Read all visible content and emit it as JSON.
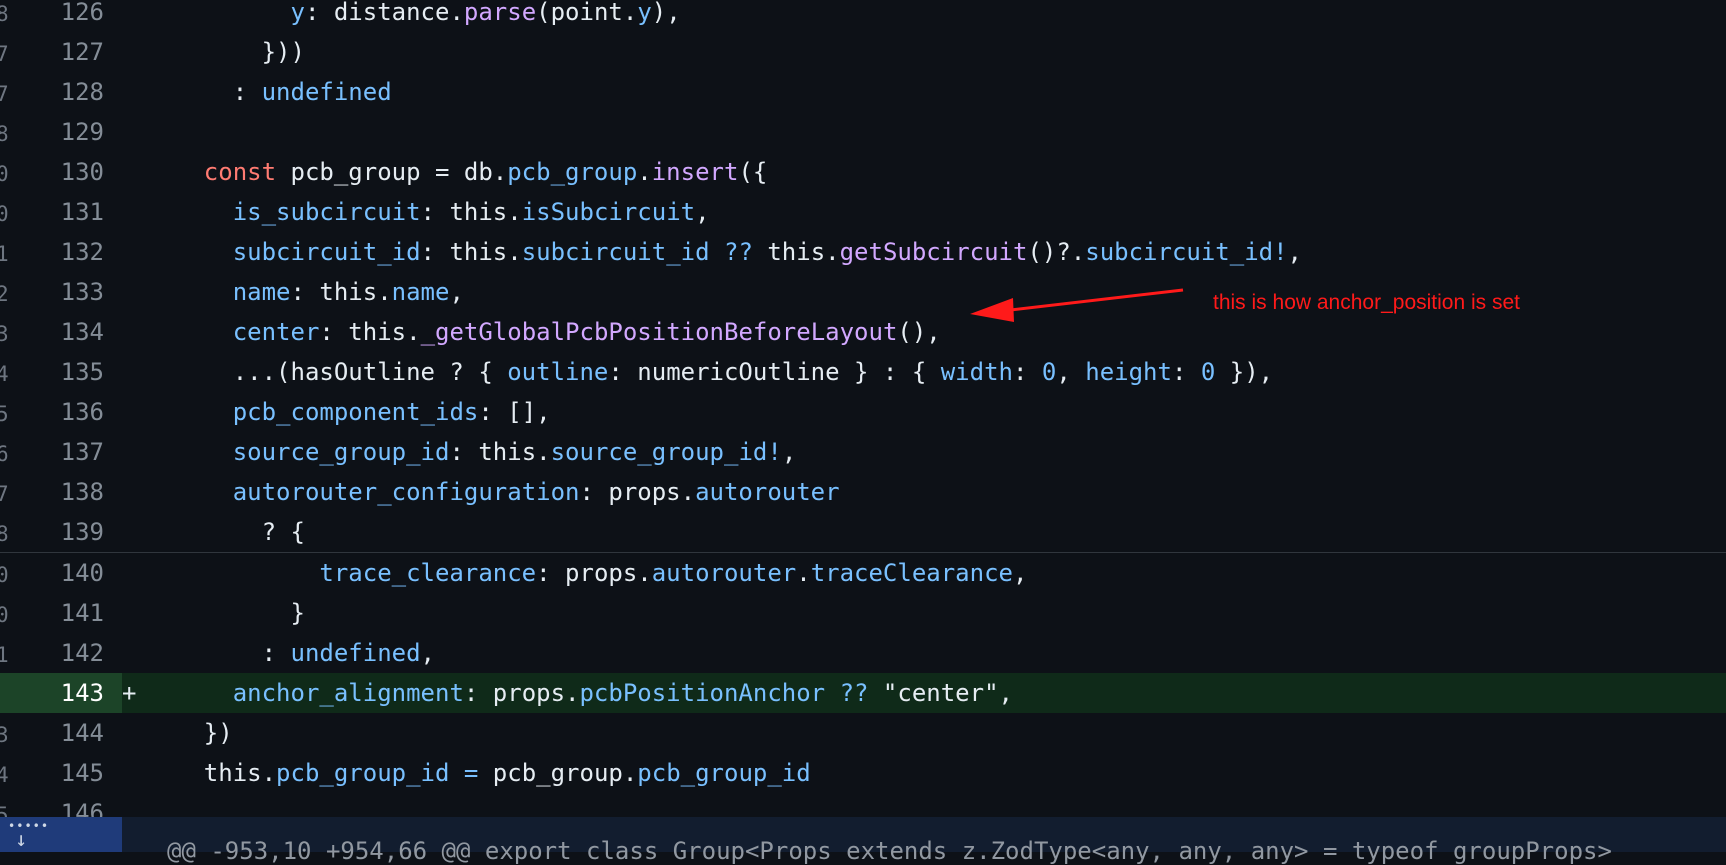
{
  "diff": {
    "lines": [
      {
        "num": "126",
        "g": "8",
        "type": "context",
        "tokens": [
          {
            "t": "          "
          },
          {
            "t": "y",
            "c": "pr"
          },
          {
            "t": ": distance."
          },
          {
            "t": "parse",
            "c": "fn"
          },
          {
            "t": "(point."
          },
          {
            "t": "y",
            "c": "pr"
          },
          {
            "t": "),"
          }
        ]
      },
      {
        "num": "127",
        "g": "7",
        "type": "context",
        "tokens": [
          {
            "t": "        }))"
          }
        ]
      },
      {
        "num": "128",
        "g": "7",
        "type": "context",
        "tokens": [
          {
            "t": "      : "
          },
          {
            "t": "undefined",
            "c": "pr"
          }
        ]
      },
      {
        "num": "129",
        "g": "8",
        "type": "context",
        "tokens": []
      },
      {
        "num": "130",
        "g": "0",
        "type": "context",
        "tokens": [
          {
            "t": "    "
          },
          {
            "t": "const",
            "c": "kw"
          },
          {
            "t": " pcb_group = db."
          },
          {
            "t": "pcb_group",
            "c": "pr"
          },
          {
            "t": "."
          },
          {
            "t": "insert",
            "c": "fn"
          },
          {
            "t": "({"
          }
        ]
      },
      {
        "num": "131",
        "g": "0",
        "type": "context",
        "tokens": [
          {
            "t": "      "
          },
          {
            "t": "is_subcircuit",
            "c": "pr"
          },
          {
            "t": ": this."
          },
          {
            "t": "isSubcircuit",
            "c": "pr"
          },
          {
            "t": ","
          }
        ]
      },
      {
        "num": "132",
        "g": "1",
        "type": "context",
        "tokens": [
          {
            "t": "      "
          },
          {
            "t": "subcircuit_id",
            "c": "pr"
          },
          {
            "t": ": this."
          },
          {
            "t": "subcircuit_id",
            "c": "pr"
          },
          {
            "t": " "
          },
          {
            "t": "??",
            "c": "pr"
          },
          {
            "t": " this."
          },
          {
            "t": "getSubcircuit",
            "c": "fn"
          },
          {
            "t": "()?."
          },
          {
            "t": "subcircuit_id",
            "c": "pr"
          },
          {
            "t": "!",
            "c": "pr"
          },
          {
            "t": ","
          }
        ]
      },
      {
        "num": "133",
        "g": "2",
        "type": "context",
        "tokens": [
          {
            "t": "      "
          },
          {
            "t": "name",
            "c": "pr"
          },
          {
            "t": ": this."
          },
          {
            "t": "name",
            "c": "pr"
          },
          {
            "t": ","
          }
        ]
      },
      {
        "num": "134",
        "g": "3",
        "type": "context",
        "tokens": [
          {
            "t": "      "
          },
          {
            "t": "center",
            "c": "pr"
          },
          {
            "t": ": this."
          },
          {
            "t": "_getGlobalPcbPositionBeforeLayout",
            "c": "fn"
          },
          {
            "t": "(),"
          }
        ]
      },
      {
        "num": "135",
        "g": "4",
        "type": "context",
        "tokens": [
          {
            "t": "      ...(hasOutline ? { "
          },
          {
            "t": "outline",
            "c": "pr"
          },
          {
            "t": ": numericOutline } : { "
          },
          {
            "t": "width",
            "c": "pr"
          },
          {
            "t": ": "
          },
          {
            "t": "0",
            "c": "pr"
          },
          {
            "t": ", "
          },
          {
            "t": "height",
            "c": "pr"
          },
          {
            "t": ": "
          },
          {
            "t": "0",
            "c": "pr"
          },
          {
            "t": " }),"
          }
        ]
      },
      {
        "num": "136",
        "g": "5",
        "type": "context",
        "tokens": [
          {
            "t": "      "
          },
          {
            "t": "pcb_component_ids",
            "c": "pr"
          },
          {
            "t": ": [],"
          }
        ]
      },
      {
        "num": "137",
        "g": "6",
        "type": "context",
        "tokens": [
          {
            "t": "      "
          },
          {
            "t": "source_group_id",
            "c": "pr"
          },
          {
            "t": ": this."
          },
          {
            "t": "source_group_id",
            "c": "pr"
          },
          {
            "t": "!",
            "c": "pr"
          },
          {
            "t": ","
          }
        ]
      },
      {
        "num": "138",
        "g": "7",
        "type": "context",
        "tokens": [
          {
            "t": "      "
          },
          {
            "t": "autorouter_configuration",
            "c": "pr"
          },
          {
            "t": ": props."
          },
          {
            "t": "autorouter",
            "c": "pr"
          }
        ]
      },
      {
        "num": "139",
        "g": "8",
        "type": "context",
        "tokens": [
          {
            "t": "        ? {"
          }
        ]
      },
      {
        "num": "140",
        "g": "0",
        "type": "context",
        "sep": true,
        "tokens": [
          {
            "t": "            "
          },
          {
            "t": "trace_clearance",
            "c": "pr"
          },
          {
            "t": ": props."
          },
          {
            "t": "autorouter",
            "c": "pr"
          },
          {
            "t": "."
          },
          {
            "t": "traceClearance",
            "c": "pr"
          },
          {
            "t": ","
          }
        ]
      },
      {
        "num": "141",
        "g": "0",
        "type": "context",
        "tokens": [
          {
            "t": "          }"
          }
        ]
      },
      {
        "num": "142",
        "g": "1",
        "type": "context",
        "tokens": [
          {
            "t": "        : "
          },
          {
            "t": "undefined",
            "c": "pr"
          },
          {
            "t": ","
          }
        ]
      },
      {
        "num": "143",
        "g": "",
        "type": "added",
        "marker": "+",
        "tokens": [
          {
            "t": "      "
          },
          {
            "t": "anchor_alignment",
            "c": "pr"
          },
          {
            "t": ": props."
          },
          {
            "t": "pcbPositionAnchor",
            "c": "pr"
          },
          {
            "t": " "
          },
          {
            "t": "??",
            "c": "pr"
          },
          {
            "t": " \"center\","
          }
        ]
      },
      {
        "num": "144",
        "g": "3",
        "type": "context",
        "tokens": [
          {
            "t": "    })"
          }
        ]
      },
      {
        "num": "145",
        "g": "4",
        "type": "context",
        "tokens": [
          {
            "t": "    this."
          },
          {
            "t": "pcb_group_id",
            "c": "pr"
          },
          {
            "t": " "
          },
          {
            "t": "=",
            "c": "pr"
          },
          {
            "t": " pcb_group."
          },
          {
            "t": "pcb_group_id",
            "c": "pr"
          }
        ]
      },
      {
        "num": "146",
        "g": "5",
        "type": "context",
        "tokens": []
      }
    ],
    "hunk_header": "@@ -953,10 +954,66 @@ export class Group<Props extends z.ZodType<any, any, any> = typeof groupProps>"
  },
  "annotation": {
    "text": "this is how anchor_position is set",
    "color": "#ff1a1a"
  },
  "icons": {
    "expand": "expand-down-icon"
  }
}
